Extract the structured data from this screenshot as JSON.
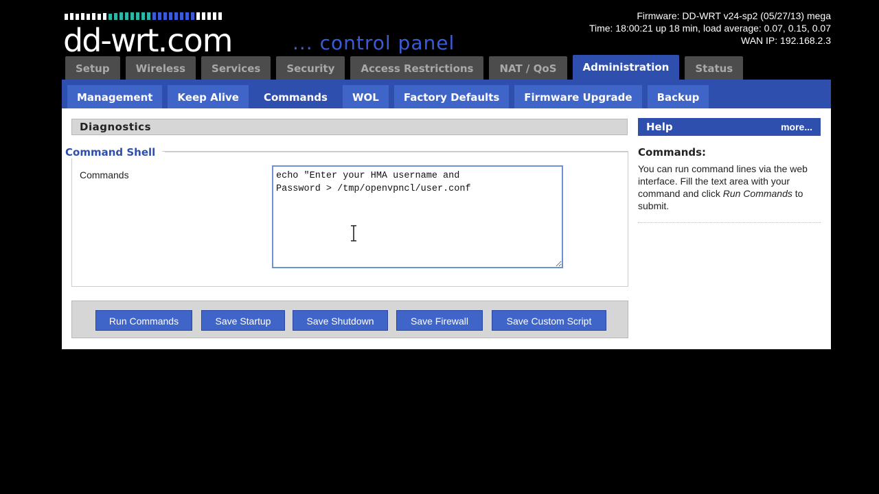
{
  "header": {
    "brand": "dd-wrt",
    "brand_suffix": ".com",
    "subtitle": "... control panel",
    "firmware": "Firmware: DD-WRT v24-sp2 (05/27/13) mega",
    "time": "Time: 18:00:21 up 18 min, load average: 0.07, 0.15, 0.07",
    "wan_ip": "WAN IP: 192.168.2.3",
    "bar_colors": [
      "#ffffff",
      "#2fb5a8",
      "#3b5bd6"
    ]
  },
  "main_tabs": [
    {
      "label": "Setup"
    },
    {
      "label": "Wireless"
    },
    {
      "label": "Services"
    },
    {
      "label": "Security"
    },
    {
      "label": "Access Restrictions"
    },
    {
      "label": "NAT / QoS"
    },
    {
      "label": "Administration",
      "active": true
    },
    {
      "label": "Status"
    }
  ],
  "sub_tabs": [
    {
      "label": "Management"
    },
    {
      "label": "Keep Alive"
    },
    {
      "label": "Commands",
      "active": true
    },
    {
      "label": "WOL"
    },
    {
      "label": "Factory Defaults"
    },
    {
      "label": "Firmware Upgrade"
    },
    {
      "label": "Backup"
    }
  ],
  "diagnostics": {
    "title": "Diagnostics",
    "section": "Command Shell",
    "commands_label": "Commands",
    "commands_value": "echo \"Enter your HMA username and\nPassword > /tmp/openvpncl/user.conf"
  },
  "buttons": {
    "run": "Run Commands",
    "save_startup": "Save Startup",
    "save_shutdown": "Save Shutdown",
    "save_firewall": "Save Firewall",
    "save_custom": "Save Custom Script"
  },
  "help": {
    "title": "Help",
    "more": "more...",
    "heading": "Commands:",
    "text_pre": "You can run command lines via the web interface. Fill the text area with your command and click ",
    "text_em": "Run Commands",
    "text_post": " to submit."
  },
  "colors": {
    "accent": "#2f4fae",
    "tab_inactive": "#4c4c4c",
    "button": "#3f65c9"
  }
}
